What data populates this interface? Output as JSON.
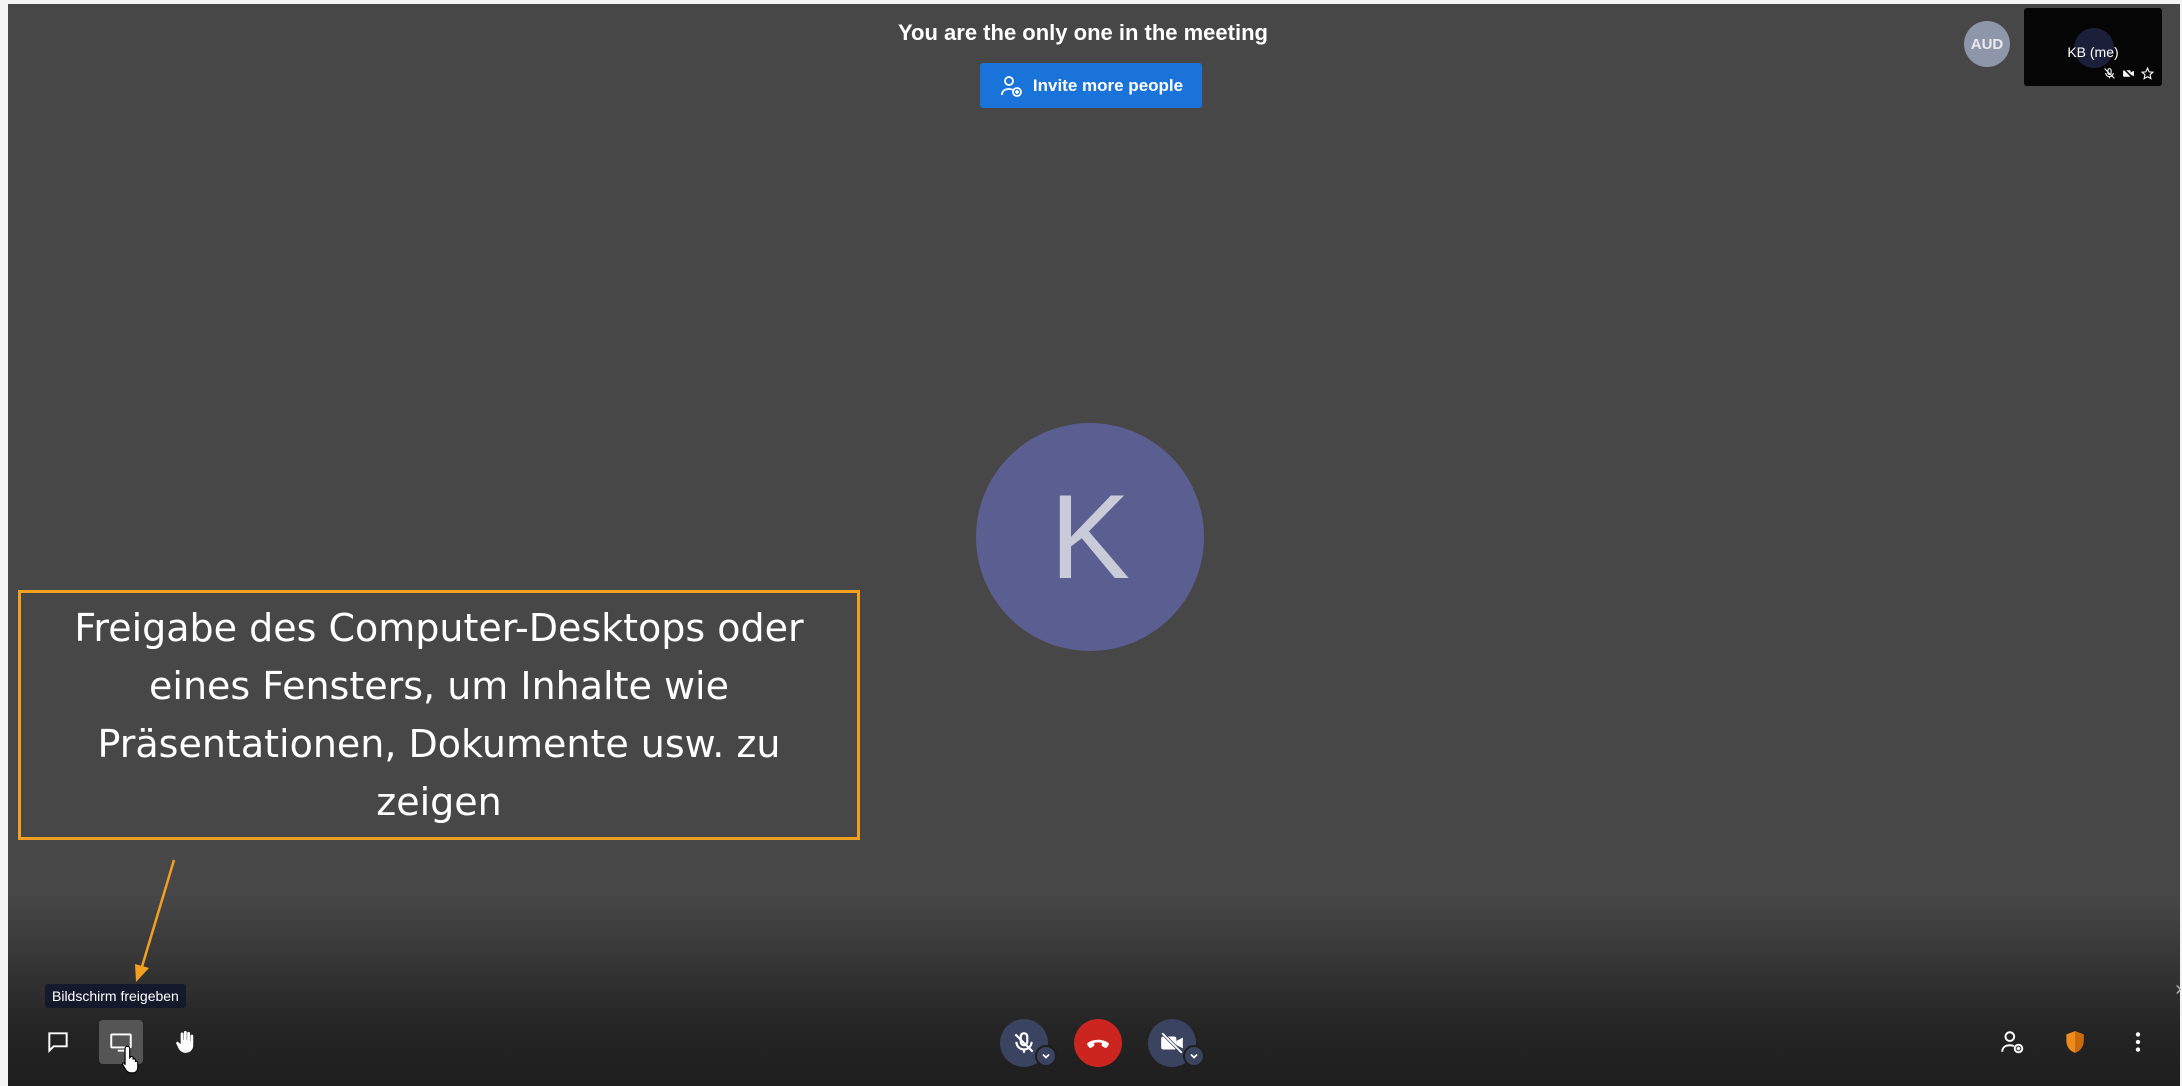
{
  "header": {
    "title": "You are the only one in the meeting",
    "invite_label": "Invite more people"
  },
  "participants": {
    "aud_avatar": "AUD",
    "self_name": "KB (me)",
    "main_initial": "K"
  },
  "callout": {
    "text": "Freigabe des Computer-Desktops oder eines Fensters, um Inhalte wie Präsentationen, Dokumente usw. zu zeigen",
    "border_color": "#f2a020"
  },
  "tooltip": {
    "text": "Bildschirm freigeben"
  },
  "toolbar": {
    "left": [
      "chat-icon",
      "screen-share-icon",
      "raise-hand-icon"
    ],
    "center": [
      "mic-muted-icon",
      "hangup-icon",
      "camera-off-icon"
    ],
    "right": [
      "participants-icon",
      "security-shield-icon",
      "more-options-icon"
    ]
  },
  "colors": {
    "invite_button": "#1a73d9",
    "hangup": "#cc2520",
    "avatar_main": "#5b5e91",
    "background": "#474747"
  }
}
